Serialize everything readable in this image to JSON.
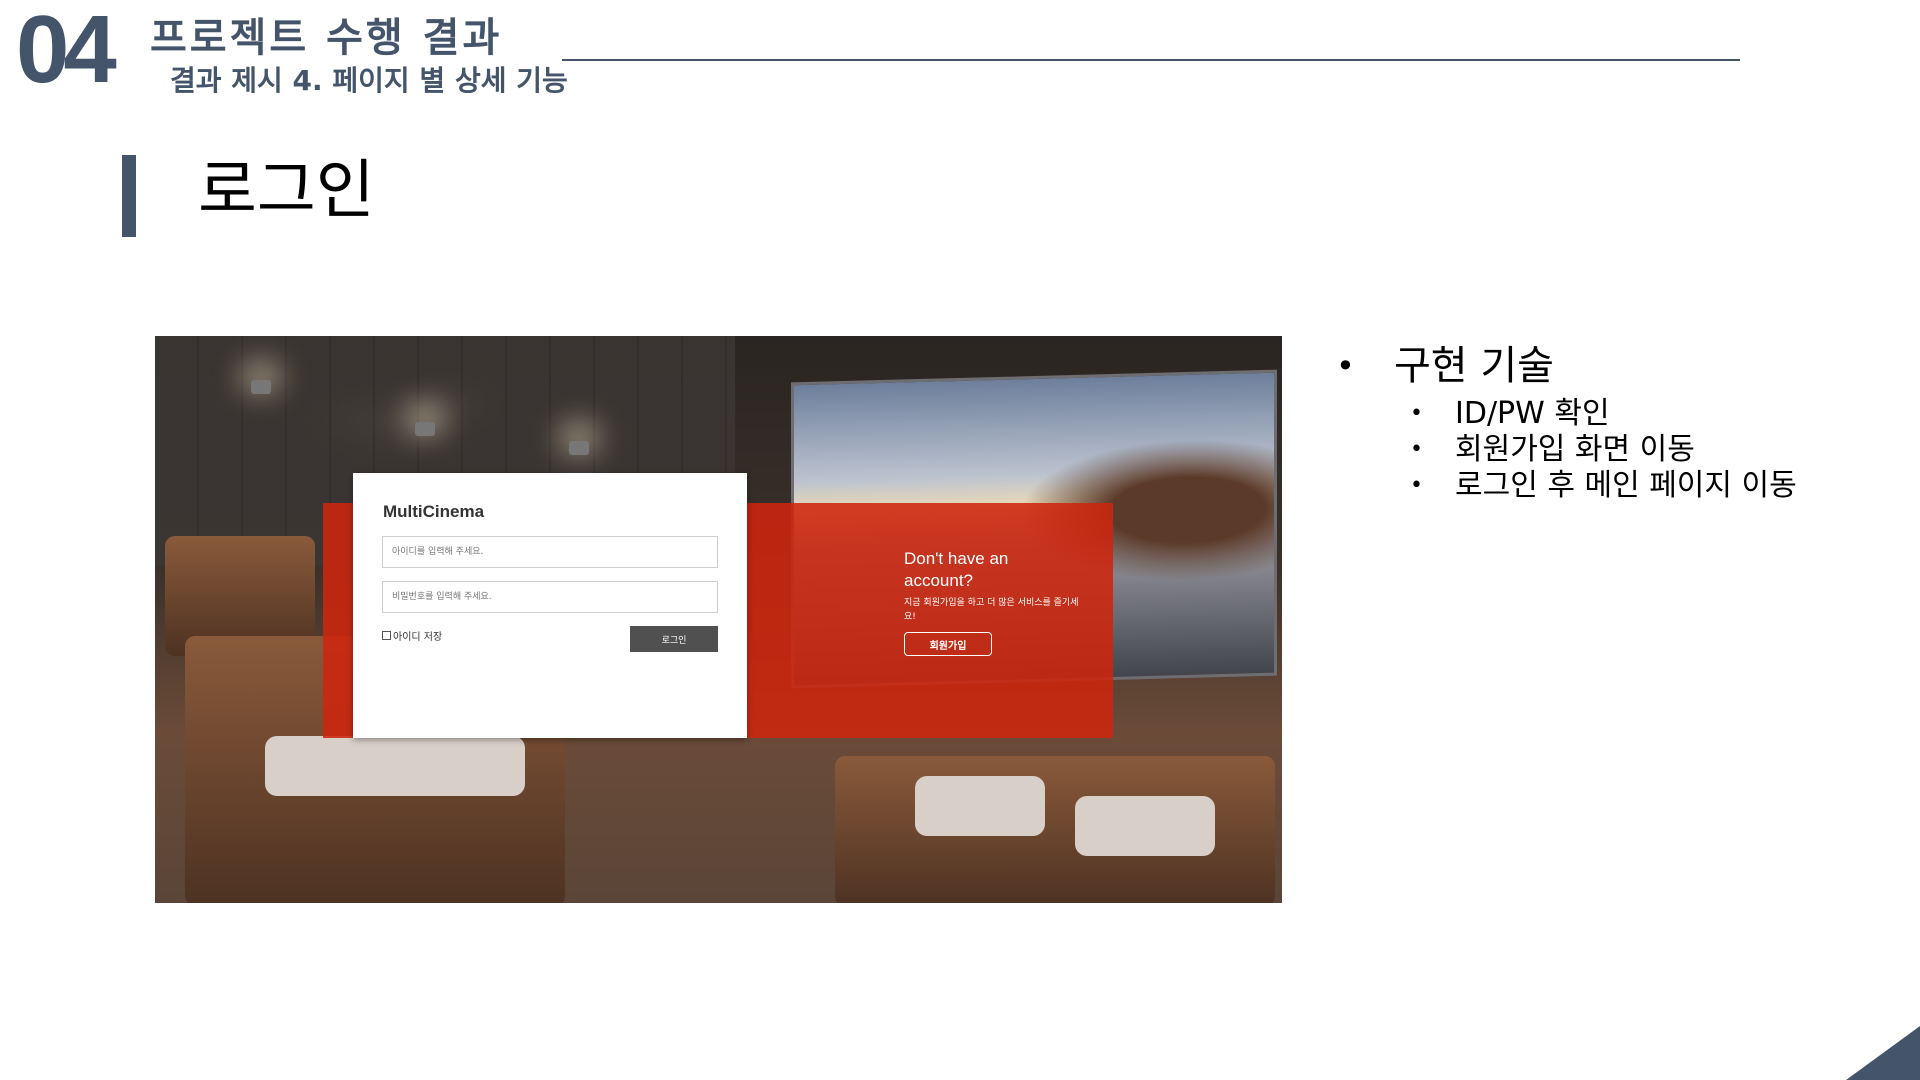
{
  "header": {
    "section_number": "04",
    "section_title": "프로젝트 수행 결과",
    "section_subtitle": "결과 제시 4. 페이지 별 상세 기능"
  },
  "page_title": "로그인",
  "screenshot": {
    "brand": "MultiCinema",
    "id_placeholder": "아이디를 입력해 주세요.",
    "pw_placeholder": "비밀번호를 입력해 주세요.",
    "save_id_label": "아이디 저장",
    "login_button": "로그인",
    "signup_heading": "Don't have an account?",
    "signup_desc": "지금 회원가입을 하고 더 많은 서비스를 즐기세요!",
    "signup_button": "회원가입"
  },
  "bullets": {
    "main": "구현 기술",
    "items": [
      "ID/PW 확인",
      "회원가입 화면 이동",
      "로그인 후 메인 페이지 이동"
    ]
  },
  "colors": {
    "accent": "#44546a",
    "panel_red": "#cd260e",
    "login_button_bg": "#505050"
  }
}
